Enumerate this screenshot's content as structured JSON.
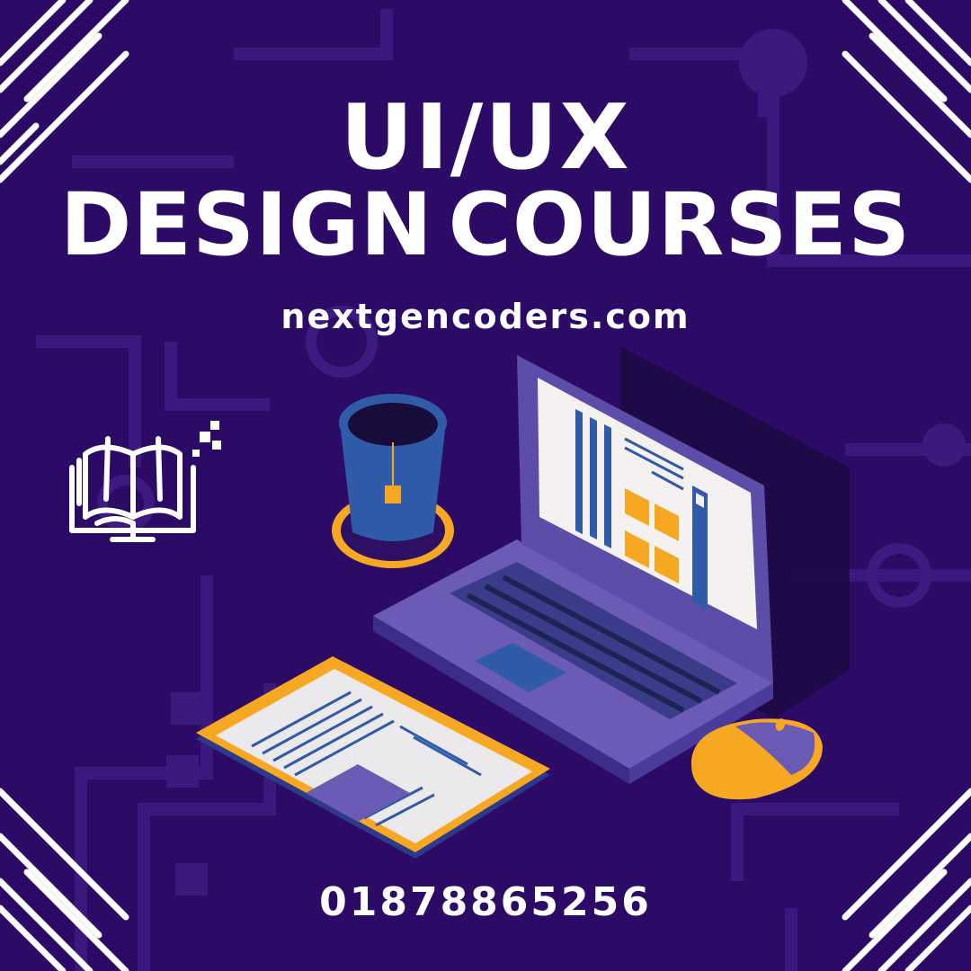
{
  "headline": {
    "line1": "UI/UX",
    "line2": "DESIGN COURSES"
  },
  "website": "nextgencoders.com",
  "phone": "01878865256",
  "colors": {
    "background": "#2c0b66",
    "text": "#ffffff",
    "accent_orange": "#f7a823",
    "laptop_purple": "#6b5bb5",
    "cup_blue": "#2f5ba8"
  },
  "icons": [
    "open-book-icon",
    "laptop-illustration",
    "tea-cup-illustration",
    "tablet-illustration",
    "mouse-illustration"
  ]
}
